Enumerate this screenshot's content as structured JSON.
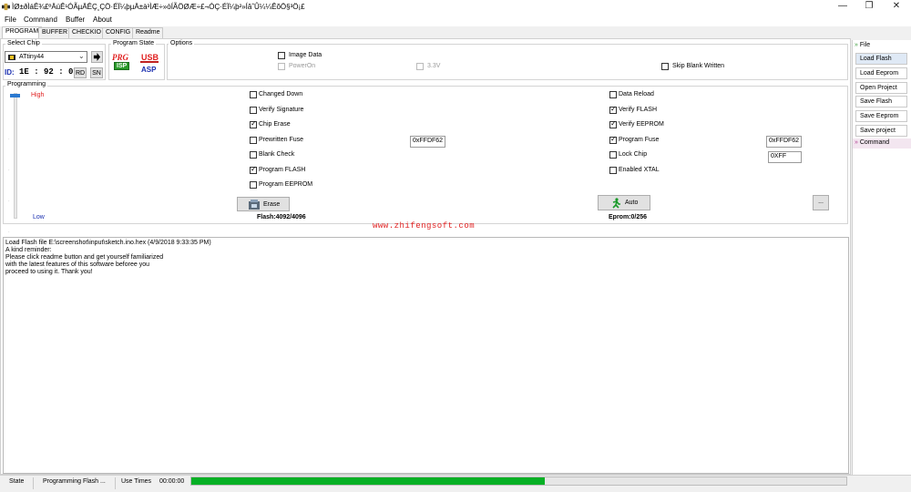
{
  "window": {
    "title": "ÌØ±ðÌáÊ¾£ºÄúÊ¹ÓÃµÄÊÇ¸ÇÖ·ÉÏ¼þµÄ±à³ÌÆ÷»òÍÃÖØÆ÷£¬ÓÇ·ÉÏ¼þ²»ÍâˆÛ¼¼ÊõÖ§³Ö¡£",
    "minimize": "—",
    "maximize": "❐",
    "close": "✕"
  },
  "menu": [
    "File",
    "Command",
    "Buffer",
    "About"
  ],
  "tabs": [
    "PROGRAM",
    "BUFFER",
    "CHECKIO",
    "CONFIG",
    "Readme"
  ],
  "select_chip": {
    "label": "Select Chip",
    "chip": "ATtiny44",
    "id_label": "ID:",
    "id_value": "1E : 92 : 07",
    "rd": "RD",
    "sn": "SN"
  },
  "program_state": {
    "label": "Program State",
    "prg": "PRG",
    "isp": "ISP",
    "usb": "USB",
    "asp": "ASP"
  },
  "options": {
    "label": "Options",
    "image_data": "Image Data",
    "power_on": "PowerOn",
    "voltage": "3.3V",
    "skip_blank": "Skip Blank Written"
  },
  "programming": {
    "label": "Programming",
    "high": "High",
    "low": "Low",
    "left_checks": [
      {
        "label": "Changed Down",
        "checked": false
      },
      {
        "label": "Verify Signature",
        "checked": false
      },
      {
        "label": "Chip Erase",
        "checked": true
      },
      {
        "label": "Prewritten Fuse",
        "checked": false
      },
      {
        "label": "Blank Check",
        "checked": false
      },
      {
        "label": "Program FLASH",
        "checked": true
      },
      {
        "label": "Program EEPROM",
        "checked": false
      }
    ],
    "right_checks": [
      {
        "label": "Data Reload",
        "checked": false
      },
      {
        "label": "Verify FLASH",
        "checked": true
      },
      {
        "label": "Verify EEPROM",
        "checked": true
      },
      {
        "label": "Program Fuse",
        "checked": true
      },
      {
        "label": "Lock Chip",
        "checked": false
      },
      {
        "label": "Enabled XTAL",
        "checked": false
      }
    ],
    "prewritten_fuse_value": "0xFFDF62",
    "program_fuse_value": "0xFFDF62",
    "lock_value": "0XFF",
    "erase_button": "Erase",
    "auto_button": "Auto",
    "more_button": "...",
    "flash_info": "Flash:4092/4096",
    "eprom_info": "Eprom:0/256",
    "website": "www.zhifengsoft.com"
  },
  "log": [
    "Load Flash file E:\\screenshot\\input\\sketch.ino.hex (4/9/2018 9:33:35 PM)",
    "A kind reminder:",
    "Please click readme button and get yourself familiarized",
    "with the latest features of this software beforee you",
    "proceed to using it. Thank you!"
  ],
  "side": {
    "file_header": "File",
    "buttons": [
      "Load Flash",
      "Load Eeprom",
      "Open Project",
      "Save Flash",
      "Save Eeprom",
      "Save project"
    ],
    "command_header": "Command"
  },
  "status": {
    "state": "State",
    "message": "Programming Flash ...",
    "use_times": "Use Times",
    "time": "00:00:00",
    "progress_percent": 54,
    "progress_color": "#06b025"
  }
}
